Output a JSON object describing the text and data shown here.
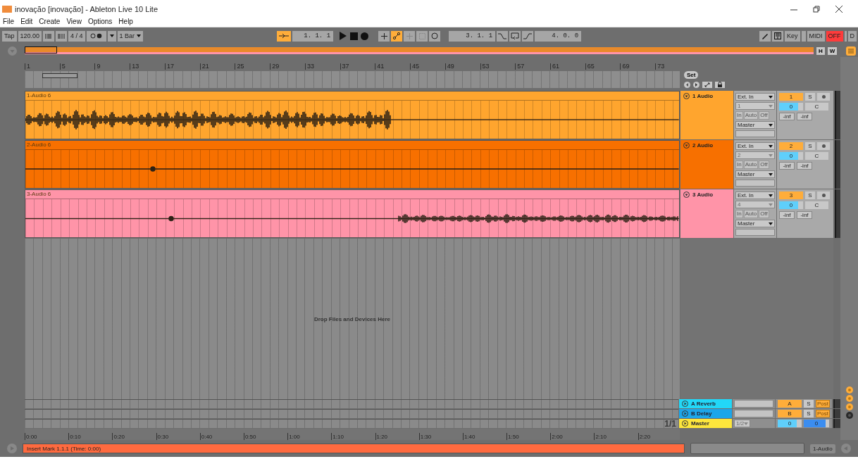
{
  "window": {
    "title": "inovação  [inovação] - Ableton Live 10 Lite"
  },
  "menu": [
    "File",
    "Edit",
    "Create",
    "View",
    "Options",
    "Help"
  ],
  "toolbar": {
    "tap": "Tap",
    "tempo": "120.00",
    "signature": "4 / 4",
    "quantize": "1 Bar",
    "follow_on": true,
    "position": "1.   1.   1",
    "automation_on": true,
    "loop_start": "3.   1.   1",
    "loop_length": "4.   0.   0",
    "key": "Key",
    "midi": "MIDI",
    "off": "OFF",
    "d": "D"
  },
  "overview": {
    "buttons": [
      "H",
      "W"
    ]
  },
  "ruler": {
    "bars": [
      "1",
      "5",
      "9",
      "13",
      "17",
      "21",
      "25",
      "29",
      "33",
      "37",
      "41",
      "45",
      "49",
      "53",
      "57",
      "61",
      "65",
      "69",
      "73"
    ],
    "set": "Set"
  },
  "tracks": [
    {
      "clip": "1-Audio 6",
      "name": "1 Audio",
      "color": "#ffa52e",
      "input": "Ext. In",
      "channel": "1",
      "monitor": [
        "In",
        "Auto",
        "Off"
      ],
      "output": "Master",
      "number": "1",
      "solo": "S",
      "volume": "0",
      "pan": "C",
      "meters": [
        "-inf",
        "-inf"
      ]
    },
    {
      "clip": "2-Audio 6",
      "name": "2 Audio",
      "color": "#f77000",
      "input": "Ext. In",
      "channel": "2",
      "monitor": [
        "In",
        "Auto",
        "Off"
      ],
      "output": "Master",
      "number": "2",
      "solo": "S",
      "volume": "0",
      "pan": "C",
      "meters": [
        "-inf",
        "-inf"
      ]
    },
    {
      "clip": "3-Audio 6",
      "name": "3 Audio",
      "color": "#ff94a8",
      "input": "Ext. In",
      "channel": "4",
      "monitor": [
        "In",
        "Auto",
        "Off"
      ],
      "output": "Master",
      "number": "3",
      "solo": "S",
      "volume": "0",
      "pan": "C",
      "meters": [
        "-inf",
        "-inf"
      ]
    }
  ],
  "drop_hint": "Drop Files and Devices Here",
  "returns": [
    {
      "name": "A Reverb",
      "color": "#22d8f8",
      "send": "A",
      "solo": "S",
      "post": "Post"
    },
    {
      "name": "B Delay",
      "color": "#1ca6ea",
      "send": "B",
      "solo": "S",
      "post": "Post"
    }
  ],
  "master": {
    "name": "Master",
    "color": "#fde63c",
    "output": "1/2",
    "volume": "0",
    "cue": "0"
  },
  "page": "1/1",
  "time_ruler": [
    "0:00",
    "0:10",
    "0:20",
    "0:30",
    "0:40",
    "0:50",
    "1:00",
    "1:10",
    "1:20",
    "1:30",
    "1:40",
    "1:50",
    "2:00",
    "2:10",
    "2:20"
  ],
  "status": {
    "message": "Insert Mark 1.1.1 (Time: 0:00)",
    "track": "1-Audio"
  }
}
